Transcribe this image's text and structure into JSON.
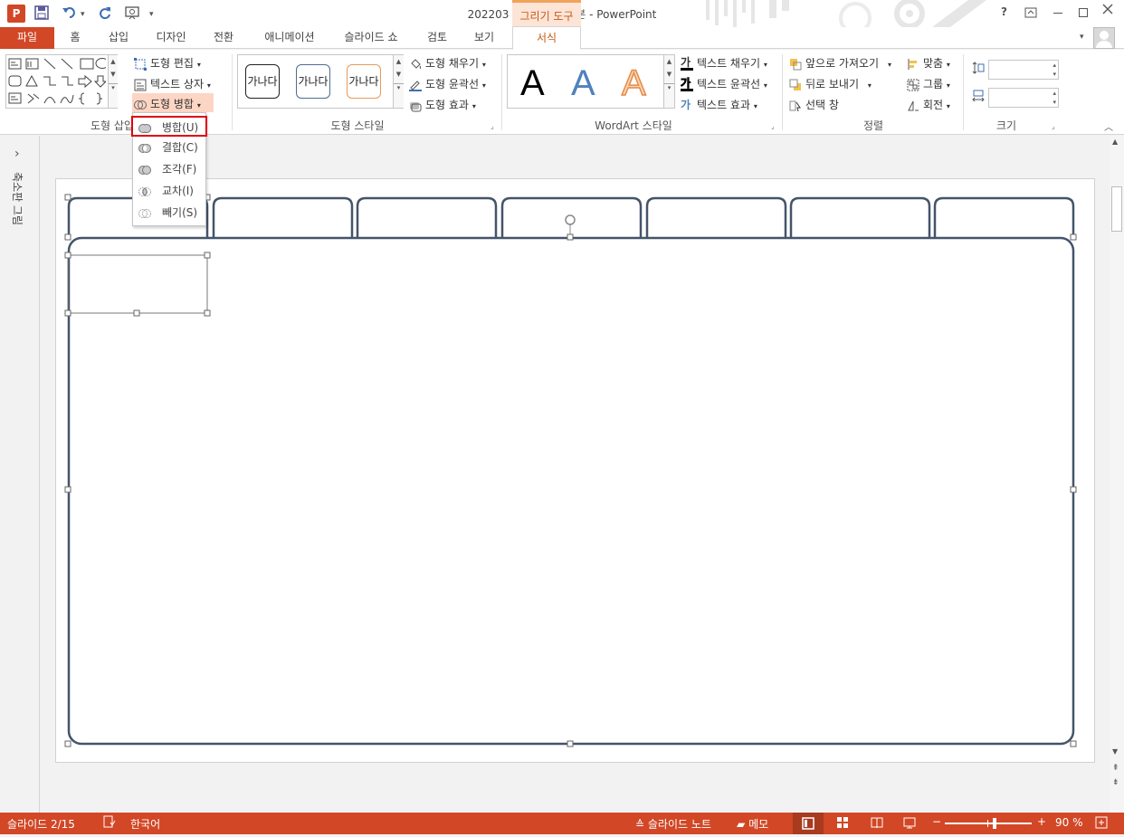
{
  "app": {
    "title": "202203 포스팅용 완성본 - PowerPoint",
    "context_group": "그리기 도구",
    "accent": "#d24726",
    "help": "?",
    "qat_dropdown": "▾"
  },
  "tabs": [
    "파일",
    "홈",
    "삽입",
    "디자인",
    "전환",
    "애니메이션",
    "슬라이드 쇼",
    "검토",
    "보기",
    "서식"
  ],
  "ribbon": {
    "insert_shapes": {
      "label": "도형 삽입",
      "edit_shape": "도형 편집",
      "text_box": "텍스트 상자",
      "merge_shapes": "도형 병합"
    },
    "shape_styles": {
      "label": "도형 스타일",
      "samples": [
        "가나다",
        "가나다",
        "가나다"
      ],
      "fill": "도형 채우기",
      "outline": "도형 윤곽선",
      "effects": "도형 효과"
    },
    "wordart": {
      "label": "WordArt 스타일",
      "letters": [
        "A",
        "A",
        "A"
      ],
      "text_fill": "텍스트 채우기",
      "text_outline": "텍스트 윤곽선",
      "text_effects": "텍스트 효과"
    },
    "arrange": {
      "label": "정렬",
      "bring_forward": "앞으로 가져오기",
      "send_backward": "뒤로 보내기",
      "selection_pane": "선택 창",
      "align": "맞춤",
      "group": "그룹",
      "rotate": "회전"
    },
    "size": {
      "label": "크기",
      "height": "",
      "width": ""
    }
  },
  "merge_menu": [
    "병합(U)",
    "결합(C)",
    "조각(F)",
    "교차(I)",
    "빼기(S)"
  ],
  "thumbnail_pane": {
    "label": "축소판 그림",
    "expand": "›"
  },
  "status": {
    "slide": "슬라이드 2/15",
    "language": "한국어",
    "notes": "슬라이드 노트",
    "comments": "메모",
    "zoom": "90 %",
    "zoom_minus": "−",
    "zoom_plus": "+",
    "zoom_level": 0.57
  }
}
